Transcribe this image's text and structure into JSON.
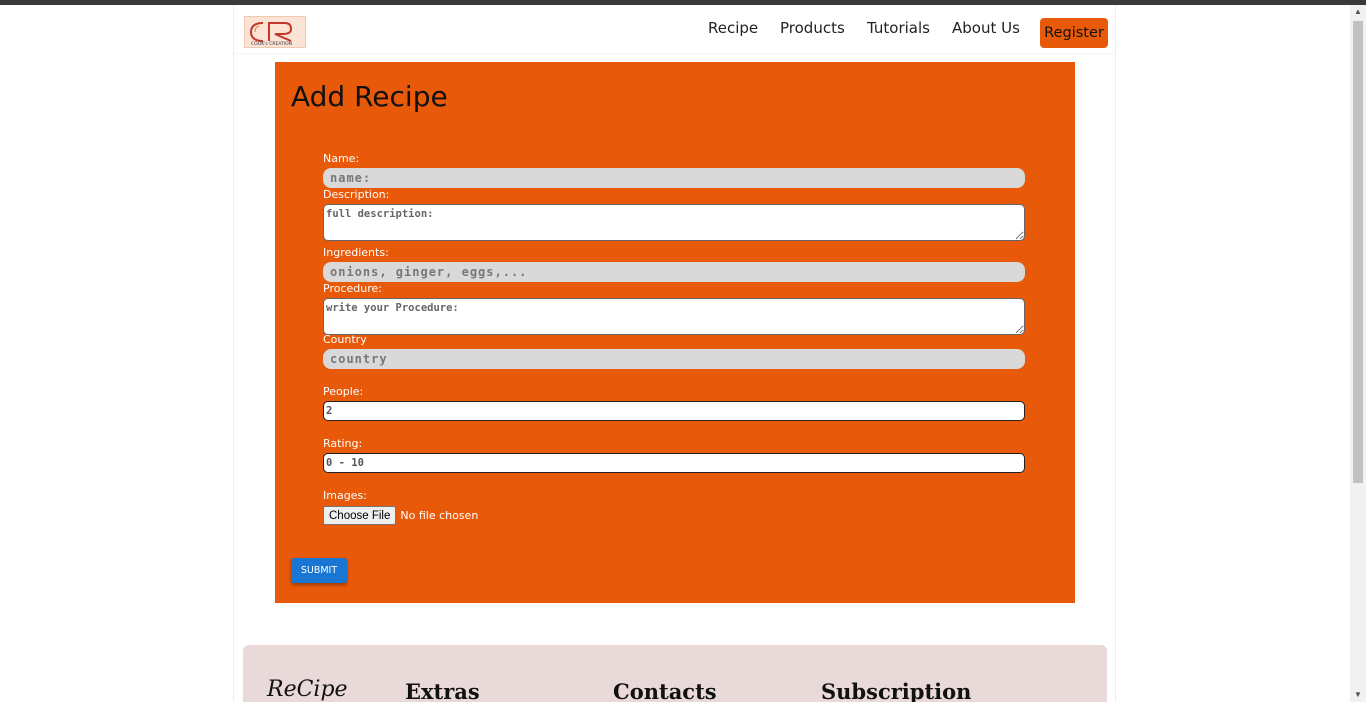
{
  "header": {
    "logo_text": "CR",
    "logo_subtext": "COOK's CREATION",
    "nav": [
      "Recipe",
      "Products",
      "Tutorials",
      "About Us"
    ],
    "register_label": "Register"
  },
  "form": {
    "title": "Add Recipe",
    "name_label": "Name:",
    "name_placeholder": "name:",
    "description_label": "Description:",
    "description_placeholder": "full description:",
    "ingredients_label": "Ingredients:",
    "ingredients_placeholder": "onions, ginger, eggs,...",
    "procedure_label": "Procedure:",
    "procedure_placeholder": "write your Procedure:",
    "country_label": "Country",
    "country_placeholder": "country",
    "people_label": "People:",
    "people_value": "2",
    "rating_label": "Rating:",
    "rating_placeholder": "0 - 10",
    "images_label": "Images:",
    "file_button": "Choose File",
    "file_status": "No file chosen",
    "submit_label": "SUBMIT"
  },
  "footer": {
    "brand": "ReCipe",
    "headings": [
      "Extras",
      "Contacts",
      "Subscription"
    ]
  },
  "colors": {
    "accent": "#e9590a",
    "submit": "#1976d2",
    "footer_bg": "#ead9d9"
  }
}
